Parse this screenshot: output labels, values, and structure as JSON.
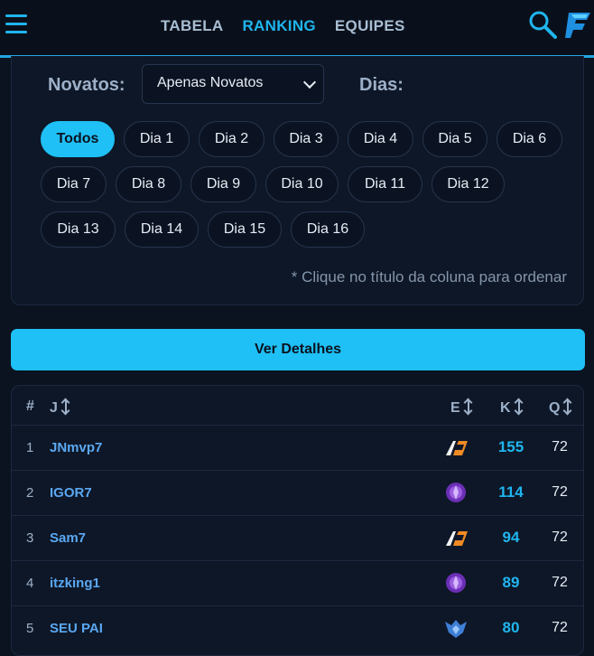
{
  "nav": {
    "items": [
      "TABELA",
      "RANKING",
      "EQUIPES"
    ],
    "active": "RANKING"
  },
  "filters": {
    "novatos_label": "Novatos:",
    "novatos_selected": "Apenas Novatos",
    "dias_label": "Dias:",
    "days": [
      "Todos",
      "Dia 1",
      "Dia 2",
      "Dia 3",
      "Dia 4",
      "Dia 5",
      "Dia 6",
      "Dia 7",
      "Dia 8",
      "Dia 9",
      "Dia 10",
      "Dia 11",
      "Dia 12",
      "Dia 13",
      "Dia 14",
      "Dia 15",
      "Dia 16"
    ],
    "active_day": "Todos",
    "hint": "* Clique no título da coluna para ordenar"
  },
  "details_button": "Ver Detalhes",
  "table": {
    "headers": {
      "rank": "#",
      "player": "J",
      "team": "E",
      "kills": "K",
      "q": "Q"
    },
    "rows": [
      {
        "rank": "1",
        "player": "JNmvp7",
        "team_icon": "team-logo-white-orange-icon",
        "kills": "155",
        "q": "72"
      },
      {
        "rank": "2",
        "player": "IGOR7",
        "team_icon": "team-logo-purple-icon",
        "kills": "114",
        "q": "72"
      },
      {
        "rank": "3",
        "player": "Sam7",
        "team_icon": "team-logo-white-orange-icon",
        "kills": "94",
        "q": "72"
      },
      {
        "rank": "4",
        "player": "itzking1",
        "team_icon": "team-logo-purple-icon",
        "kills": "89",
        "q": "72"
      },
      {
        "rank": "5",
        "player": "SEU PAI",
        "team_icon": "team-logo-blue-icon",
        "kills": "80",
        "q": "72"
      }
    ]
  },
  "colors": {
    "accent": "#1fc0f5",
    "background": "#0b1220",
    "card": "#0e1727",
    "player_link": "#5aa8f2"
  }
}
